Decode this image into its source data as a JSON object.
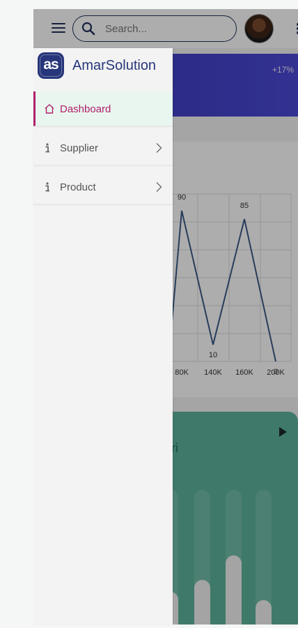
{
  "header": {
    "search_placeholder": "Search..."
  },
  "banner": {
    "change": "+17%"
  },
  "chart_data": {
    "type": "line",
    "x": [
      "80K",
      "140K",
      "160K",
      "200K"
    ],
    "values": [
      90,
      10,
      85,
      0
    ],
    "data_labels": [
      "90",
      "10",
      "85",
      "0"
    ],
    "color": "#3a5b87",
    "grid": true
  },
  "bars": {
    "title": "ri",
    "levels": [
      0.3,
      0.38,
      0.55,
      0.24
    ],
    "track_color": "#70bda8",
    "fill_color": "#f2f2f2"
  },
  "drawer": {
    "brand": "AmarSolution",
    "logo_text": "as",
    "items": [
      {
        "label": "Dashboard",
        "icon": "home-icon",
        "active": true
      },
      {
        "label": "Supplier",
        "icon": "info-icon",
        "chevron": true
      },
      {
        "label": "Product",
        "icon": "info-icon",
        "chevron": true
      }
    ]
  },
  "colors": {
    "accent": "#b0206a",
    "brand": "#27367a",
    "banner": "#3a38b8",
    "card": "#5eb39c"
  }
}
